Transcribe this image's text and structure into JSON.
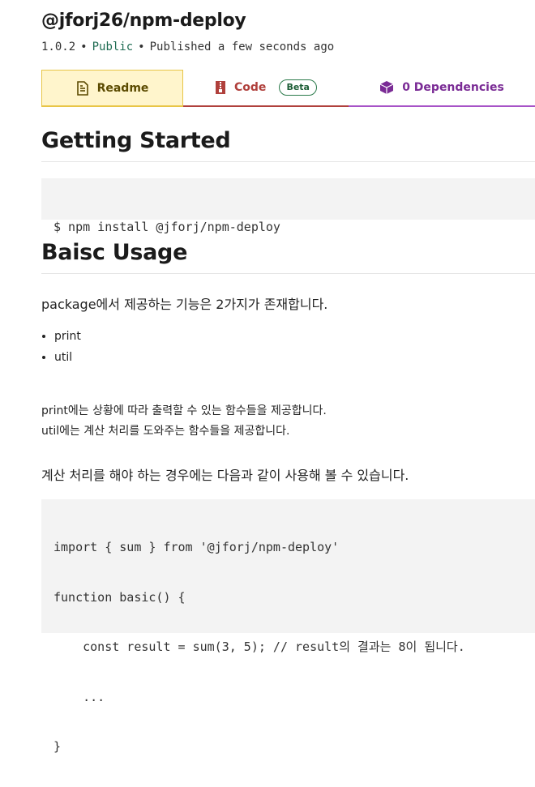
{
  "package": {
    "name": "@jforj26/npm-deploy",
    "version": "1.0.2",
    "separator": "•",
    "visibility": "Public",
    "published": "Published a few seconds ago"
  },
  "tabs": [
    {
      "label": "Readme",
      "icon": "document-icon"
    },
    {
      "label": "Code",
      "icon": "zip-file-icon",
      "badge": "Beta"
    },
    {
      "label": "0 Dependencies",
      "icon": "cube-icon"
    }
  ],
  "readme": {
    "heading_getting_started": "Getting Started",
    "install_command": "$ npm install @jforj/npm-deploy",
    "heading_usage": "Baisc Usage",
    "intro": "package에서 제공하는 기능은 2가지가 존재합니다.",
    "features": [
      "print",
      "util"
    ],
    "desc_lines": [
      "print에는 상황에 따라 출력할 수 있는 함수들을 제공합니다.",
      "util에는 계산 처리를 도와주는 함수들을 제공합니다."
    ],
    "usage_intro": "계산 처리를 해야 하는 경우에는 다음과 같이 사용해 볼 수 있습니다.",
    "code_lines": [
      "import { sum } from '@jforj/npm-deploy'",
      "function basic() {",
      "    const result = sum(3, 5); // result의 결과는 8이 됩니다.",
      "    ...",
      "}"
    ]
  },
  "colors": {
    "readme_tab_bg": "#fff5cc",
    "readme_tab_border": "#e8c547",
    "code_tab": "#b0403c",
    "deps_tab": "#a753c7",
    "public_green": "#1e6b52",
    "code_bg": "#f3f3f3"
  }
}
